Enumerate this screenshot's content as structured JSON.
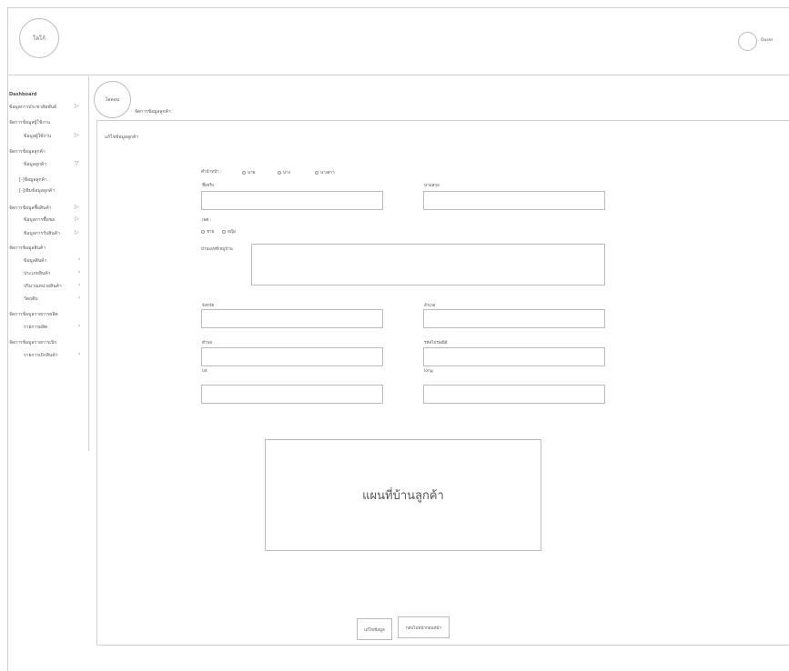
{
  "header": {
    "logo_label": "โลโก้",
    "user_label": "Ouser"
  },
  "sidebar": {
    "dashboard": "Dashboard",
    "items": [
      {
        "label": "ข้อมูลการประชาสัมพันธ์"
      },
      {
        "label": "จัดการข้อมูลผู้ใช้งาน"
      },
      {
        "label": "ข้อมูลผู้ใช้งาน"
      },
      {
        "label": "จัดการข้อมูลลูกค้า"
      },
      {
        "label": "ข้อมูลลูกค้า"
      },
      {
        "label": "[-]ข้อมูลลูกค้า"
      },
      {
        "label": "[-]เพิ่มข้อมูลลูกค้า"
      },
      {
        "label": "จัดการข้อมูลซื้อสินค้า"
      },
      {
        "label": "ข้อมูลการซื้อขอ"
      },
      {
        "label": "ข้อมูลการรับสินค้า"
      },
      {
        "label": "จัดการข้อมูลสินค้า"
      },
      {
        "label": "ข้อมูลสินค้า"
      },
      {
        "label": "ประเภทสินค้า"
      },
      {
        "label": "ปริมาณหน่วยสินค้า"
      },
      {
        "label": "วัตถุดิบ"
      },
      {
        "label": "จัดการข้อมูลรายการผลิต"
      },
      {
        "label": "รายการผลิต"
      },
      {
        "label": "จัดการข้อมูลรายการเบิก"
      },
      {
        "label": "รายการเบิกสินค้า"
      }
    ]
  },
  "page": {
    "circle_label": "ไอคอน",
    "breadcrumb": "จัดการข้อมูลลูกค้า",
    "section_title": "แก้ไขข้อมูลลูกค้า"
  },
  "form": {
    "prefix_label": "คำนำหน้า :",
    "prefix_options": [
      "นาย",
      "นาง",
      "นางสาว"
    ],
    "firstname_label": "ชื่อจริง",
    "lastname_label": "นามสกุล",
    "gender_label": "เพศ :",
    "gender_options": [
      "ชาย",
      "หญิง"
    ],
    "address_label": "บ้านเลขที่/หมู่บ้าน",
    "province_label": "จังหวัด",
    "district_label": "อำเภอ",
    "subdistrict_label": "ตำบล",
    "postcode_label": "รหัสไปรษณีย์",
    "lat_label": "lat",
    "long_label": "long"
  },
  "map": {
    "label": "แผนที่บ้านลูกค้า"
  },
  "buttons": {
    "save": "แก้ไขข้อมูล",
    "back": "กลับไปหน้าก่อนหน้า"
  },
  "icons": {
    "sidebar_arrow": "chevron-right-icon",
    "sidebar_expand": "chevron-down-icon"
  }
}
